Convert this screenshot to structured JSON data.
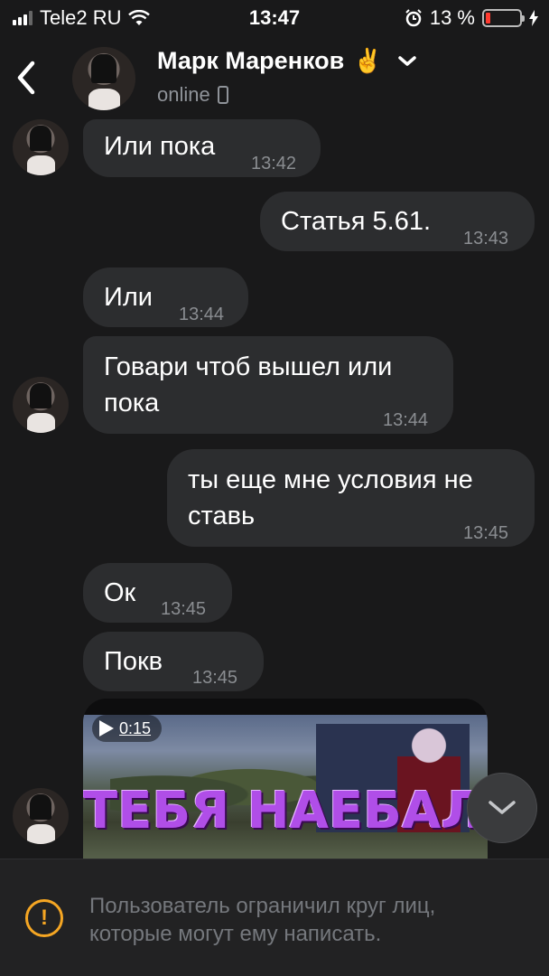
{
  "status_bar": {
    "carrier": "Tele2 RU",
    "time": "13:47",
    "battery_percent": "13 %",
    "battery_level": 0.13
  },
  "header": {
    "contact_name": "Марк Маренков",
    "name_emoji": "✌️",
    "status": "online",
    "icons": [
      "back-chevron-icon",
      "chevron-down-icon",
      "phone-icon"
    ]
  },
  "messages": [
    {
      "text": "Или пока",
      "time": "13:42",
      "outgoing": false
    },
    {
      "text": "Статья 5.61.",
      "time": "13:43",
      "outgoing": true
    },
    {
      "text": "Или",
      "time": "13:44",
      "outgoing": false
    },
    {
      "text": "Говари чтоб вышел или пока",
      "time": "13:44",
      "outgoing": false
    },
    {
      "text": "ты еще мне условия не ставь",
      "time": "13:45",
      "outgoing": true
    },
    {
      "text": "Ок",
      "time": "13:45",
      "outgoing": false
    },
    {
      "text": "Покв",
      "time": "13:45",
      "outgoing": false
    }
  ],
  "video": {
    "duration": "0:15",
    "caption": "ТЕБЯ НАЕБАЛИ"
  },
  "footer": {
    "notice": "Пользователь ограничил круг лиц, которые могут ему написать.",
    "icon": "warning-icon",
    "accent_color": "#f5a623"
  }
}
